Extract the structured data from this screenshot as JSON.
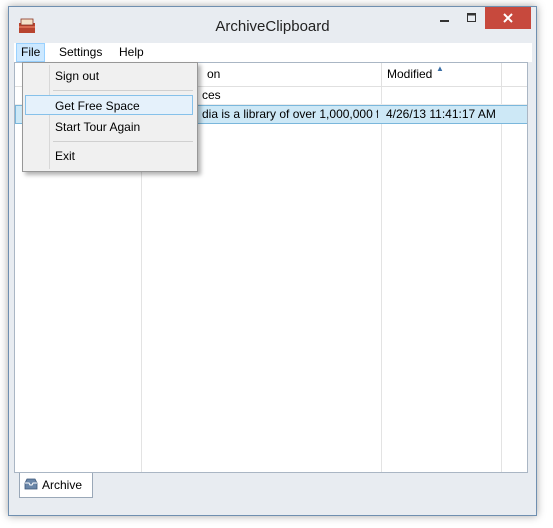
{
  "window": {
    "title": "ArchiveClipboard"
  },
  "menu": {
    "file": "File",
    "settings": "Settings",
    "help": "Help"
  },
  "file_menu": {
    "items": [
      "Sign out",
      "Get Free Space",
      "Start Tour Again",
      "Exit"
    ],
    "hovered_item": "Get Free Space"
  },
  "table": {
    "columns": [
      "",
      "on",
      "Modified"
    ],
    "sort_column": "Modified",
    "rows": [
      {
        "c1": "",
        "c2": "ces",
        "c3": ""
      },
      {
        "c1": "",
        "c2": "dia is a library of over 1,000,000 f...",
        "c3": "4/26/13 11:41:17 AM"
      }
    ],
    "selected_row": 1
  },
  "tabs": [
    {
      "label": "Archive",
      "icon": "inbox-icon"
    }
  ],
  "colors": {
    "close_button": "#c7493d",
    "selection": "#cde8f6",
    "menu_highlight": "#e5f1fb"
  }
}
